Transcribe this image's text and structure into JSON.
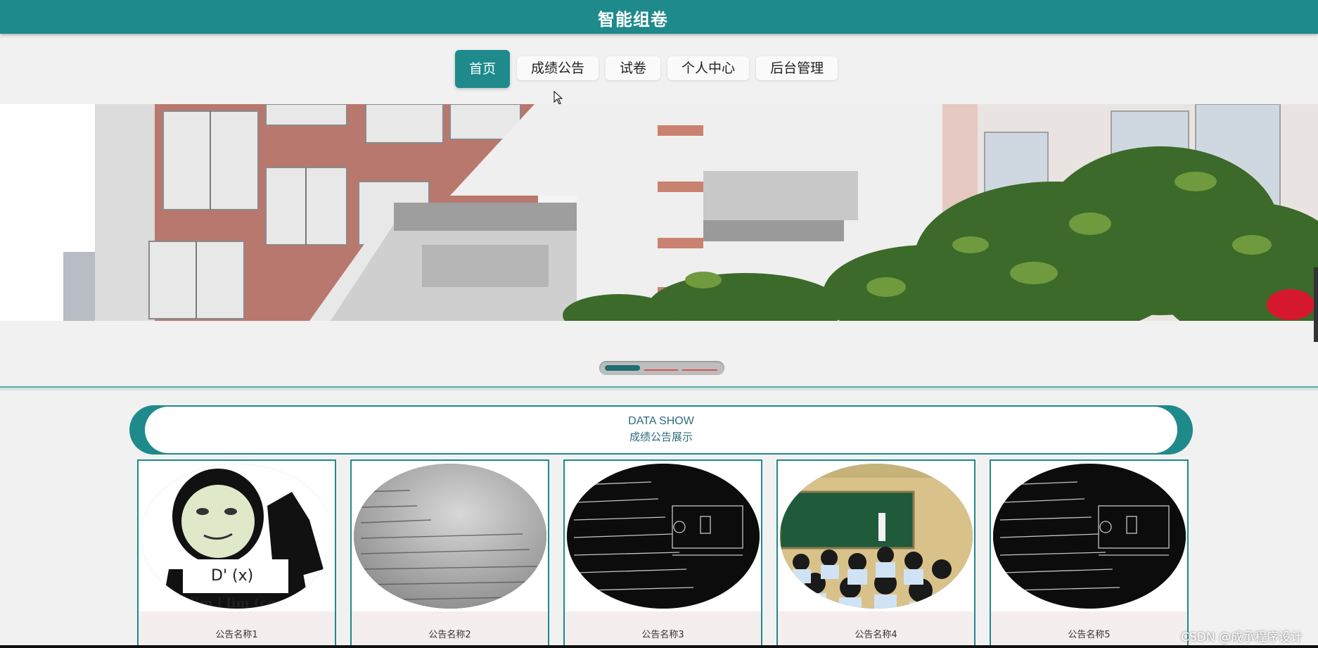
{
  "header": {
    "title": "智能组卷"
  },
  "nav": {
    "items": [
      {
        "label": "首页",
        "active": true
      },
      {
        "label": "成绩公告"
      },
      {
        "label": "试卷"
      },
      {
        "label": "个人中心"
      },
      {
        "label": "后台管理"
      }
    ]
  },
  "banner": {
    "slides": 3,
    "current_slide": 1
  },
  "section": {
    "title_en": "DATA SHOW",
    "title_cn": "成绩公告展示"
  },
  "cards": [
    {
      "caption": "公告名称1",
      "meme_text": "D' (x)",
      "meme_text2": "lim | lim (cos(t"
    },
    {
      "caption": "公告名称2"
    },
    {
      "caption": "公告名称3"
    },
    {
      "caption": "公告名称4"
    },
    {
      "caption": "公告名称5"
    }
  ],
  "watermark": "CSDN @成承程序设计",
  "colors": {
    "primary": "#1e8a8c",
    "accent_red": "#d9534f"
  }
}
